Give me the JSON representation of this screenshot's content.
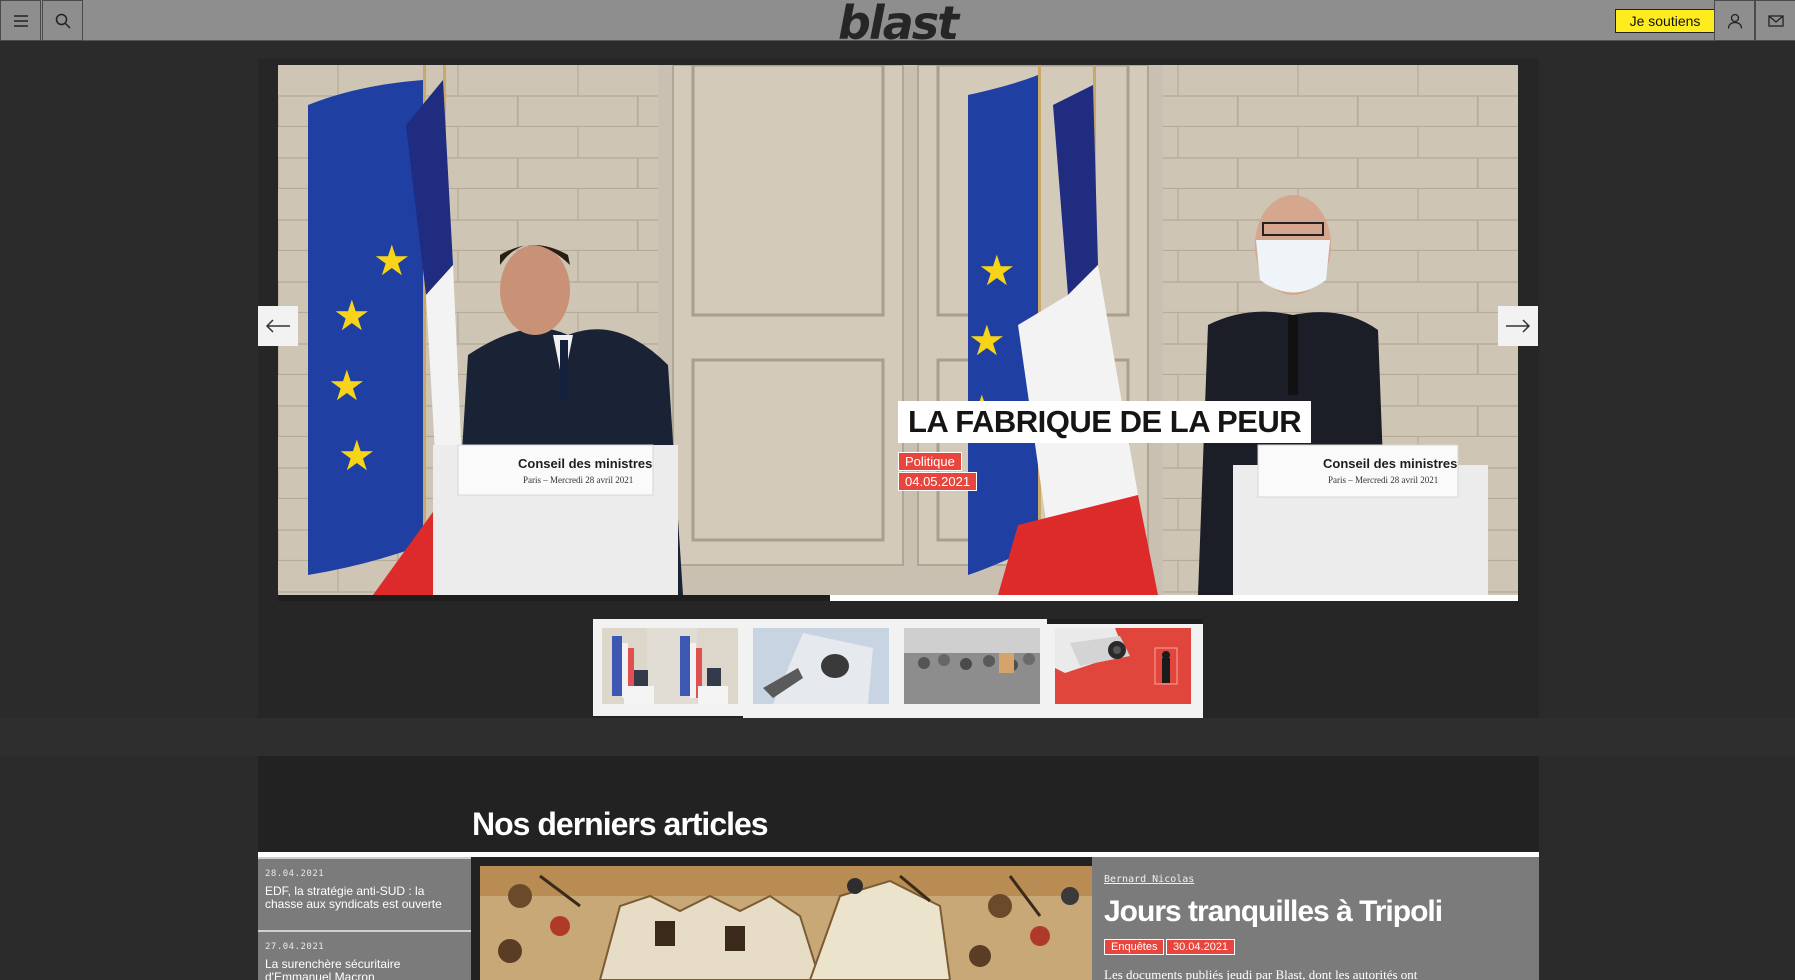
{
  "header": {
    "logo": "blast",
    "support_label": "Je soutiens",
    "menu_icon": "hamburger-icon",
    "search_icon": "search-icon",
    "user_icon": "user-icon",
    "mail_icon": "mail-icon",
    "support_color": "#ffec1f"
  },
  "hero": {
    "title": "LA FABRIQUE DE LA PEUR",
    "category": "Politique",
    "date": "04.05.2021",
    "podium_left": "Conseil des ministres",
    "podium_left_sub": "Paris – Mercredi 28 avril 2021",
    "podium_right": "Conseil des ministres",
    "podium_right_sub": "Paris – Mercredi 28 avril 2021",
    "progress": 0.445,
    "prev_icon": "arrow-left-icon",
    "next_icon": "arrow-right-icon",
    "tag_color": "#e6463d",
    "thumbnails": [
      {
        "name": "thumb-press-conference",
        "active": true
      },
      {
        "name": "thumb-corsica-flag",
        "active": false
      },
      {
        "name": "thumb-crowd",
        "active": false
      },
      {
        "name": "thumb-surveillance-camera",
        "active": false
      }
    ]
  },
  "articles": {
    "section_title": "Nos derniers articles",
    "side_items": [
      {
        "date": "28.04.2021",
        "title": "EDF, la stratégie anti-SUD : la chasse aux syndicats est ouverte"
      },
      {
        "date": "27.04.2021",
        "title": "La surenchère sécuritaire d'Emmanuel Macron"
      }
    ],
    "featured": {
      "author": "Bernard Nicolas",
      "title": "Jours tranquilles à Tripoli",
      "category": "Enquêtes",
      "date": "30.04.2021",
      "lede": "Les documents publiés jeudi par Blast, dont les autorités ont"
    }
  }
}
